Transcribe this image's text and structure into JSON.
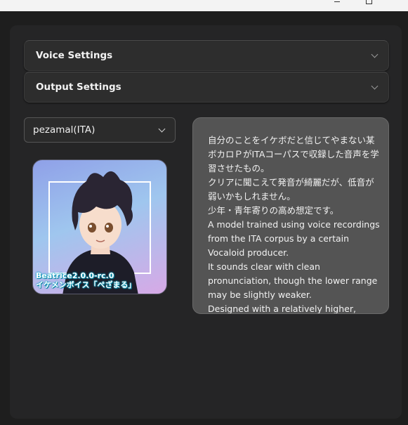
{
  "accordions": {
    "voice_settings": "Voice Settings",
    "output_settings": "Output Settings"
  },
  "model_select": {
    "selected": "pezamal(ITA)"
  },
  "portrait": {
    "caption_line1": "Beatrice2.0.0-rc.0",
    "caption_line2": "イケメンボイス「ぺざまる」"
  },
  "description": {
    "lines": [
      "自分のことをイケボだと信じてやまない某ボカロＰがITAコーパスで収録した音声を学習させたもの。",
      "クリアに聞こえて発音が綺麗だが、低音が弱いかもしれません。",
      "少年・青年寄りの高め想定です。",
      "A model trained using voice recordings from the ITA corpus by a certain Vocaloid producer.",
      "It sounds clear with clean pronunciation, though the lower range may be slightly weaker.",
      "Designed with a relatively higher,"
    ]
  },
  "icons": {
    "accordion_chevron": "chevron-down-icon",
    "select_chevron": "chevron-down-icon",
    "window_minimize": "minimize-icon",
    "window_maximize": "maximize-icon"
  }
}
